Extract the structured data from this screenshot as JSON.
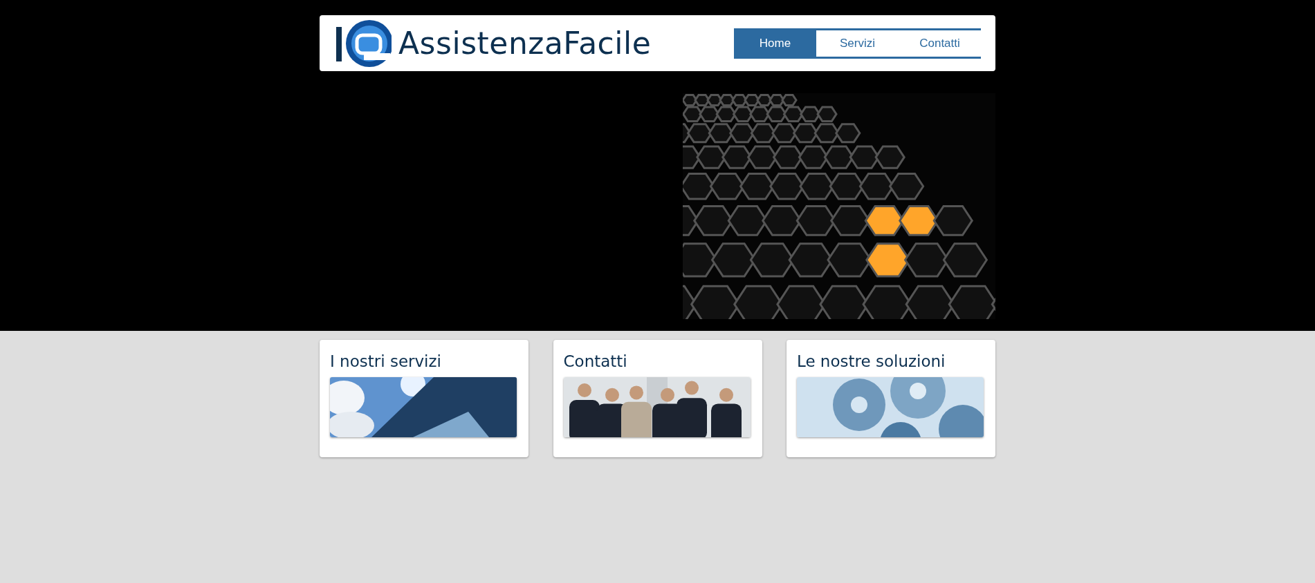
{
  "header": {
    "logo_text": "AssistenzaFacile"
  },
  "nav": [
    {
      "label": "Home",
      "selected": true
    },
    {
      "label": "Servizi",
      "selected": false
    },
    {
      "label": "Contatti",
      "selected": false
    }
  ],
  "cards": [
    {
      "title": "I nostri servizi"
    },
    {
      "title": "Contatti"
    },
    {
      "title": "Le nostre soluzioni"
    }
  ]
}
